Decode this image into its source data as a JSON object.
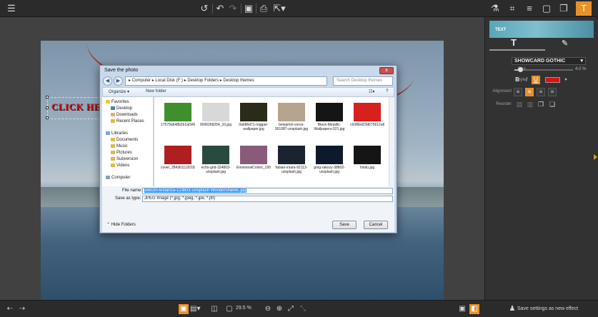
{
  "toolbar": {
    "menu_icon": "hamburger-icon",
    "actions": [
      "reset-icon",
      "undo-icon",
      "redo-icon",
      "save-icon",
      "print-icon",
      "share-icon"
    ],
    "right_tools": [
      "flask-icon",
      "crop-icon",
      "adjust-icon",
      "frame-icon",
      "layers-icon",
      "text-icon"
    ],
    "accent": "#e8912b"
  },
  "canvas": {
    "overlay_text": "CLICK HERE"
  },
  "dialog": {
    "title": "Save the photo",
    "close_glyph": "x",
    "address": "▸ Computer ▸ Local Disk (F:) ▸ Desktop Folders ▸ Desktop themes",
    "search_placeholder": "Search Desktop themes",
    "organize": "Organize ▾",
    "new_folder": "New folder",
    "nav": {
      "favorites": "Favorites",
      "desktop": "Desktop",
      "downloads": "Downloads",
      "recent": "Recent Places",
      "libraries": "Libraries",
      "documents": "Documents",
      "music": "Music",
      "pictures": "Pictures",
      "subversion": "Subversion",
      "videos": "Videos",
      "computer": "Computer"
    },
    "files": [
      {
        "label": "17579ab48b2b1af3491ae45829720215.jpg",
        "color": "#3f8f2e"
      },
      {
        "label": "0006268254_10.jpg",
        "color": "#d8d8d8"
      },
      {
        "label": "0a686d71-reggae-wallpaper.jpg",
        "color": "#2b2b1a"
      },
      {
        "label": "benjamin-voros-361087-unsplash.jpg",
        "color": "#b7a48f"
      },
      {
        "label": "Black-Metallic-Wallpapers-021.jpg",
        "color": "#151515"
      },
      {
        "label": "c93f8ed23d675612a62c9cb57aef97d.jpg",
        "color": "#d8201c"
      },
      {
        "label": "cover_284361112018_n.jpg",
        "color": "#b01f1f"
      },
      {
        "label": "echo-grid-324803-unsplash.jpg",
        "color": "#2a4a40"
      },
      {
        "label": "EmotionalColors_1900_RGB.jpg",
        "color": "#8a5a7a"
      },
      {
        "label": "fabian-irsara-92113-unsplash.jpg",
        "color": "#1b2330"
      },
      {
        "label": "greg-rakozy-38802-unsplash.jpg",
        "color": "#0e1a2c"
      },
      {
        "label": "hindu.jpg",
        "color": "#151515"
      }
    ],
    "file_name_label": "File name:",
    "file_name": "elecon-lostanza-123831-unsplash WondershareE.jpg",
    "save_type_label": "Save as type:",
    "save_type": "JPEG Image (*.jpg, *.jpeg, *.jpe, *.jfif)",
    "hide_folders": "Hide Folders",
    "save": "Save",
    "cancel": "Cancel"
  },
  "panel": {
    "banner_text": "TEXT",
    "mode_text": "T",
    "font_label": "Font",
    "font_value": "SHOWCARD GOTHIC",
    "size_label": "Size",
    "size_value": "4.0 %",
    "size_level": 0.1,
    "style_label": "Style",
    "bold": "B",
    "italic": "I",
    "underline": "U",
    "text_color": "#e01010",
    "alignment_label": "Alignment",
    "reorder_label": "Reorder"
  },
  "status": {
    "zoom": "29.5 %",
    "save_effect": "Save settings as new effect"
  }
}
